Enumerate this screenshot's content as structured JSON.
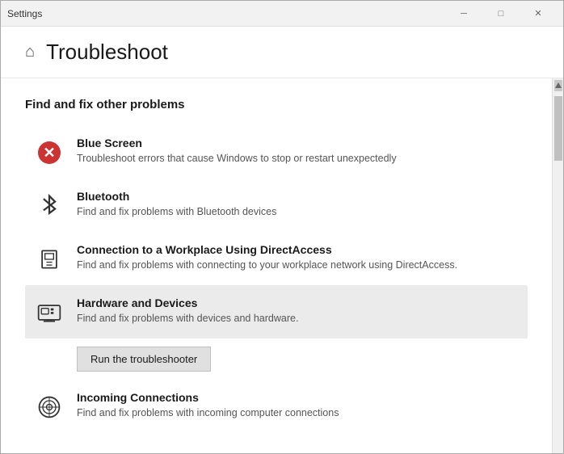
{
  "window": {
    "title": "Settings",
    "controls": {
      "minimize": "─",
      "maximize": "□",
      "close": "✕"
    }
  },
  "header": {
    "icon": "⌂",
    "title": "Troubleshoot"
  },
  "section": {
    "title": "Find and fix other problems"
  },
  "items": [
    {
      "id": "blue-screen",
      "name": "Blue Screen",
      "description": "Troubleshoot errors that cause Windows to stop or restart unexpectedly",
      "active": false
    },
    {
      "id": "bluetooth",
      "name": "Bluetooth",
      "description": "Find and fix problems with Bluetooth devices",
      "active": false
    },
    {
      "id": "connection-workplace",
      "name": "Connection to a Workplace Using DirectAccess",
      "description": "Find and fix problems with connecting to your workplace network using DirectAccess.",
      "active": false
    },
    {
      "id": "hardware-devices",
      "name": "Hardware and Devices",
      "description": "Find and fix problems with devices and hardware.",
      "active": true
    },
    {
      "id": "incoming-connections",
      "name": "Incoming Connections",
      "description": "Find and fix problems with incoming computer connections",
      "active": false
    }
  ],
  "run_button": "Run the troubleshooter"
}
